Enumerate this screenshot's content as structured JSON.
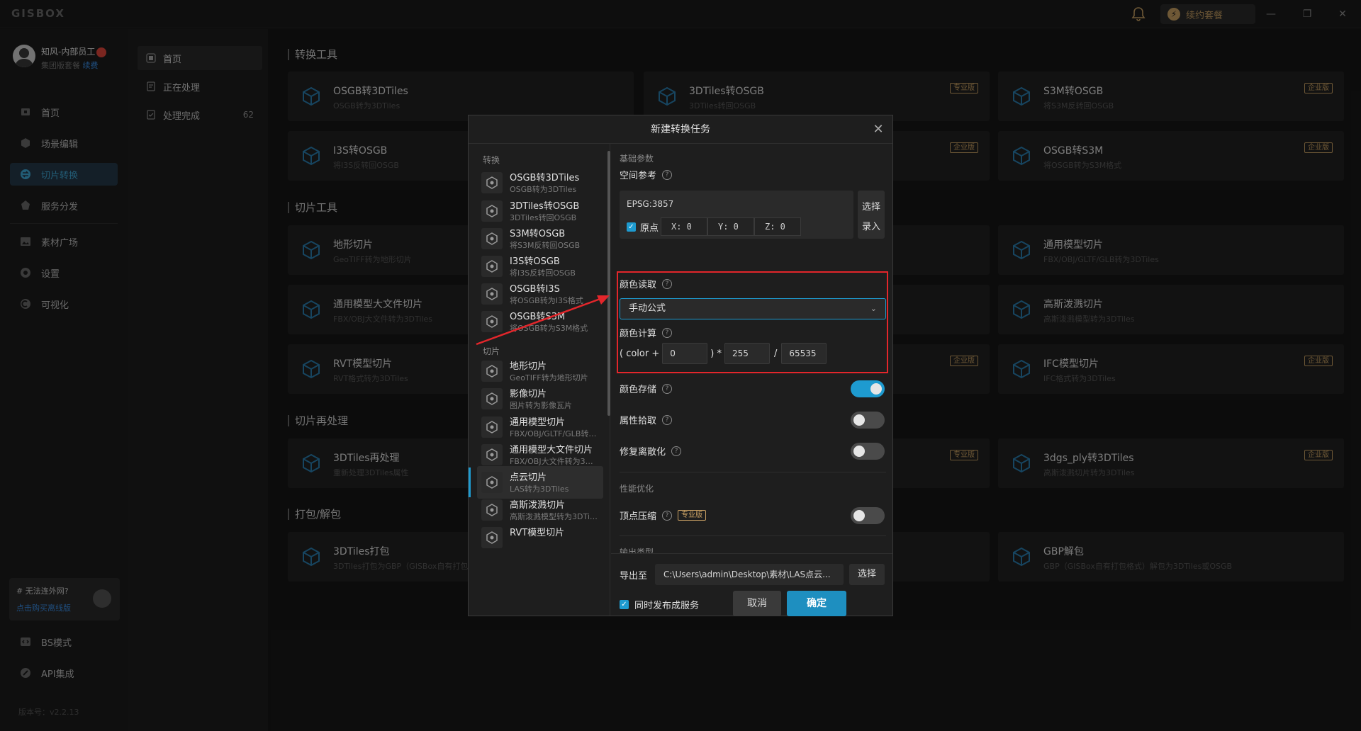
{
  "app": {
    "logo": "GISBOX",
    "renew_label": "续约套餐",
    "win_min": "—",
    "win_max": "❐",
    "win_close": "✕"
  },
  "user": {
    "name": "知风-内部员工",
    "plan": "集团版套餐",
    "plan_action": "续费"
  },
  "nav": {
    "items": [
      {
        "label": "首页",
        "icon": "home-icon"
      },
      {
        "label": "场景编辑",
        "icon": "cube-icon"
      },
      {
        "label": "切片转换",
        "icon": "convert-icon"
      },
      {
        "label": "服务分发",
        "icon": "publish-icon"
      },
      {
        "label": "素材广场",
        "icon": "image-icon"
      },
      {
        "label": "设置",
        "icon": "gear-icon"
      },
      {
        "label": "可视化",
        "icon": "visual-icon"
      }
    ],
    "offline_title": "# 无法连外网?",
    "offline_link": "点击购买离线版",
    "bs_mode": "BS模式",
    "api": "API集成",
    "version": "版本号：v2.2.13"
  },
  "subnav": {
    "items": [
      {
        "label": "首页"
      },
      {
        "label": "正在处理"
      },
      {
        "label": "处理完成",
        "count": "62"
      }
    ]
  },
  "main": {
    "sections": [
      "转换工具",
      "切片工具",
      "切片再处理",
      "打包/解包"
    ],
    "cards": [
      {
        "title": "OSGB转3DTiles",
        "sub": "OSGB转为3DTiles",
        "tag": ""
      },
      {
        "title": "3DTiles转OSGB",
        "sub": "3DTiles转回OSGB",
        "tag": "专业版"
      },
      {
        "title": "S3M转OSGB",
        "sub": "将S3M反转回OSGB",
        "tag": "企业版"
      },
      {
        "title": "I3S转OSGB",
        "sub": "将I3S反转回OSGB",
        "tag": "企业版"
      },
      {
        "title": "",
        "sub": "",
        "tag": "企业版"
      },
      {
        "title": "OSGB转S3M",
        "sub": "将OSGB转为S3M格式",
        "tag": "企业版"
      },
      {
        "title": "地形切片",
        "sub": "GeoTIFF转为地形切片",
        "tag": ""
      },
      {
        "title": "",
        "sub": "",
        "tag": ""
      },
      {
        "title": "通用模型切片",
        "sub": "FBX/OBJ/GLTF/GLB转为3DTiles",
        "tag": ""
      },
      {
        "title": "通用模型大文件切片",
        "sub": "FBX/OBJ大文件转为3DTiles",
        "tag": ""
      },
      {
        "title": "",
        "sub": "",
        "tag": ""
      },
      {
        "title": "高斯泼溅切片",
        "sub": "高斯泼溅模型转为3DTiles",
        "tag": ""
      },
      {
        "title": "RVT模型切片",
        "sub": "RVT格式转为3DTiles",
        "tag": ""
      },
      {
        "title": "",
        "sub": "",
        "tag": "企业版"
      },
      {
        "title": "IFC模型切片",
        "sub": "IFC格式转为3DTiles",
        "tag": "企业版"
      },
      {
        "title": "3DTiles再处理",
        "sub": "重新处理3DTiles属性",
        "tag": ""
      },
      {
        "title": "",
        "sub": "",
        "tag": "专业版"
      },
      {
        "title": "3dgs_ply转3DTiles",
        "sub": "高斯泼溅切片转为3DTiles",
        "tag": "企业版"
      },
      {
        "title": "3DTiles打包",
        "sub": "3DTiles打包为GBP（GISBox自有打包格式）",
        "tag": ""
      },
      {
        "title": "",
        "sub": "",
        "tag": ""
      },
      {
        "title": "GBP解包",
        "sub": "GBP（GISBox自有打包格式）解包为3DTiles或OSGB",
        "tag": ""
      }
    ]
  },
  "modal": {
    "title": "新建转换任务",
    "groups": [
      "转换",
      "切片"
    ],
    "list": [
      {
        "title": "OSGB转3DTiles",
        "sub": "OSGB转为3DTiles"
      },
      {
        "title": "3DTiles转OSGB",
        "sub": "3DTiles转回OSGB"
      },
      {
        "title": "S3M转OSGB",
        "sub": "将S3M反转回OSGB"
      },
      {
        "title": "I3S转OSGB",
        "sub": "将I3S反转回OSGB"
      },
      {
        "title": "OSGB转I3S",
        "sub": "将OSGB转为I3S格式"
      },
      {
        "title": "OSGB转S3M",
        "sub": "将OSGB转为S3M格式"
      },
      {
        "title": "地形切片",
        "sub": "GeoTIFF转为地形切片"
      },
      {
        "title": "影像切片",
        "sub": "图片转为影像瓦片"
      },
      {
        "title": "通用模型切片",
        "sub": "FBX/OBJ/GLTF/GLB转为3DTiles"
      },
      {
        "title": "通用模型大文件切片",
        "sub": "FBX/OBJ大文件转为3DTiles"
      },
      {
        "title": "点云切片",
        "sub": "LAS转为3DTiles"
      },
      {
        "title": "高斯泼溅切片",
        "sub": "高斯泼溅模型转为3DTiles"
      },
      {
        "title": "RVT模型切片",
        "sub": ""
      }
    ],
    "form": {
      "basic_group": "基础参数",
      "spatial_ref": "空间参考",
      "epsg": "EPSG:3857",
      "origin_label": "原点",
      "x": "X: 0",
      "y": "Y: 0",
      "z": "Z: 0",
      "select_line1": "选择",
      "select_line2": "录入",
      "color_read": "颜色读取",
      "color_read_value": "手动公式",
      "color_calc": "颜色计算",
      "formula_prefix": "( color +",
      "formula_a": "0",
      "formula_mid": ") *",
      "formula_b": "255",
      "formula_div": "/",
      "formula_c": "65535",
      "color_store": "颜色存储",
      "attr_pick": "属性拾取",
      "fix_discrete": "修复离散化",
      "perf_group": "性能优化",
      "vertex_compress": "顶点压缩",
      "pro_tag": "专业版",
      "output_group": "输出类型",
      "export_to": "导出至",
      "export_path": "C:\\Users\\admin\\Desktop\\素材\\LAS点云...",
      "export_select": "选择",
      "publish_label": "同时发布成服务",
      "cancel": "取消",
      "confirm": "确定"
    },
    "toggles": {
      "color_store": true,
      "attr_pick": false,
      "fix_discrete": false,
      "vertex_compress": false
    }
  }
}
